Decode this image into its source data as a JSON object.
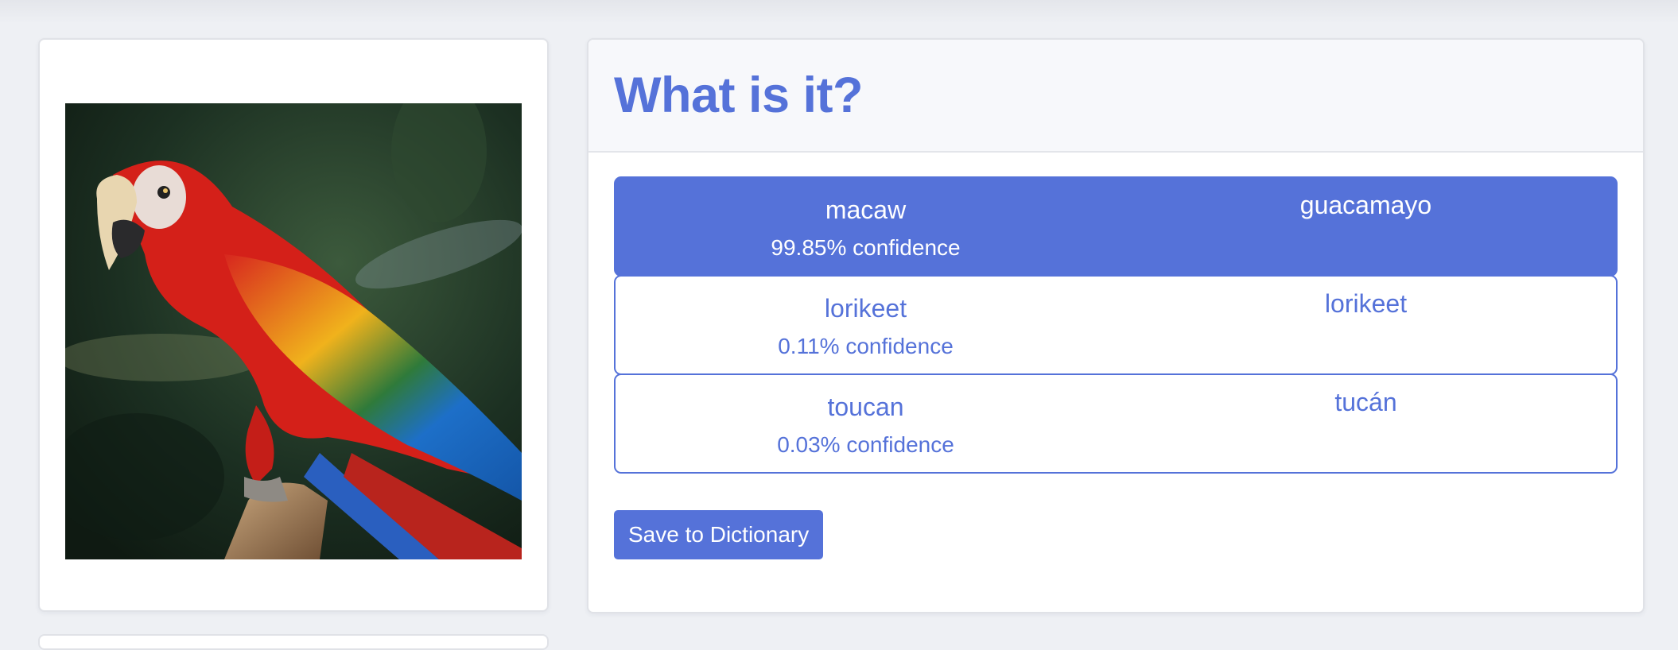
{
  "image_card": {
    "image_alt": "scarlet macaw parrot perched on a branch"
  },
  "results": {
    "title": "What is it?",
    "predictions": [
      {
        "label": "macaw",
        "confidence": "99.85% confidence",
        "translation": "guacamayo",
        "active": true
      },
      {
        "label": "lorikeet",
        "confidence": "0.11% confidence",
        "translation": "lorikeet",
        "active": false
      },
      {
        "label": "toucan",
        "confidence": "0.03% confidence",
        "translation": "tucán",
        "active": false
      }
    ],
    "save_button_label": "Save to Dictionary"
  },
  "colors": {
    "accent": "#5572d9",
    "background": "#eef0f4",
    "card": "#ffffff",
    "header_bg": "#f7f8fb"
  }
}
